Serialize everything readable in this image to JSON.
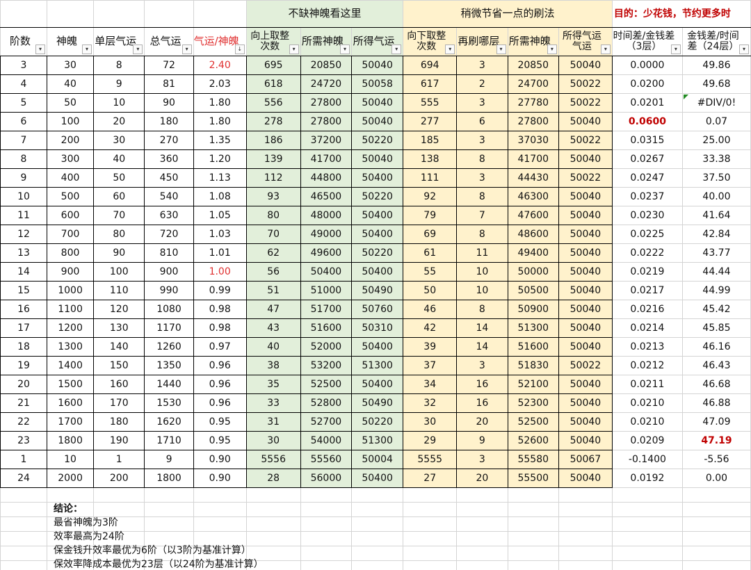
{
  "title_row": {
    "green_title": "不缺神魄看这里",
    "yellow_title": "稍微节省一点的刷法",
    "goal_text": "目的：少花钱，节约更多时"
  },
  "headers": [
    {
      "label": "阶数",
      "style": "normal"
    },
    {
      "label": "神魄",
      "style": "normal"
    },
    {
      "label": "单层气运",
      "style": "normal"
    },
    {
      "label": "总气运",
      "style": "normal"
    },
    {
      "label": "气运/神魄",
      "style": "red",
      "sort_icon": "sort-desc-icon"
    },
    {
      "label": "向上取整次数",
      "style": "green",
      "two_line": true
    },
    {
      "label": "所需神魄",
      "style": "green"
    },
    {
      "label": "所得气运",
      "style": "green"
    },
    {
      "label": "向下取整次数",
      "style": "yellow",
      "two_line": true
    },
    {
      "label": "再刷哪层",
      "style": "yellow"
    },
    {
      "label": "所需神魄",
      "style": "yellow"
    },
    {
      "label": "所得气运气运",
      "style": "yellow",
      "two_line": true
    },
    {
      "label": "时间差/金钱差（3层）",
      "style": "normal",
      "two_line": true
    },
    {
      "label": "金钱差/时间差（24层）",
      "style": "normal",
      "two_line": true
    }
  ],
  "rows": [
    {
      "cells": [
        "3",
        "30",
        "8",
        "72",
        "2.40",
        "695",
        "20850",
        "50040",
        "694",
        "3",
        "20850",
        "50040",
        "0.0000",
        "49.86"
      ],
      "flags": {
        "4": "red"
      }
    },
    {
      "cells": [
        "4",
        "40",
        "9",
        "81",
        "2.03",
        "618",
        "24720",
        "50058",
        "617",
        "2",
        "24700",
        "50022",
        "0.0200",
        "49.68"
      ]
    },
    {
      "cells": [
        "5",
        "50",
        "10",
        "90",
        "1.80",
        "556",
        "27800",
        "50040",
        "555",
        "3",
        "27780",
        "50022",
        "0.0201",
        "#DIV/0!"
      ],
      "flags": {
        "13": "tri"
      }
    },
    {
      "cells": [
        "6",
        "100",
        "20",
        "180",
        "1.80",
        "278",
        "27800",
        "50040",
        "277",
        "6",
        "27800",
        "50040",
        "0.0600",
        "0.07"
      ],
      "flags": {
        "12": "bold-red"
      }
    },
    {
      "cells": [
        "7",
        "200",
        "30",
        "270",
        "1.35",
        "186",
        "37200",
        "50220",
        "185",
        "3",
        "37030",
        "50022",
        "0.0315",
        "25.00"
      ]
    },
    {
      "cells": [
        "8",
        "300",
        "40",
        "360",
        "1.20",
        "139",
        "41700",
        "50040",
        "138",
        "8",
        "41700",
        "50040",
        "0.0267",
        "33.38"
      ]
    },
    {
      "cells": [
        "9",
        "400",
        "50",
        "450",
        "1.13",
        "112",
        "44800",
        "50400",
        "111",
        "3",
        "44430",
        "50022",
        "0.0247",
        "37.50"
      ]
    },
    {
      "cells": [
        "10",
        "500",
        "60",
        "540",
        "1.08",
        "93",
        "46500",
        "50220",
        "92",
        "8",
        "46300",
        "50040",
        "0.0237",
        "40.00"
      ]
    },
    {
      "cells": [
        "11",
        "600",
        "70",
        "630",
        "1.05",
        "80",
        "48000",
        "50400",
        "79",
        "7",
        "47600",
        "50040",
        "0.0230",
        "41.64"
      ]
    },
    {
      "cells": [
        "12",
        "700",
        "80",
        "720",
        "1.03",
        "70",
        "49000",
        "50400",
        "69",
        "8",
        "48600",
        "50040",
        "0.0225",
        "42.84"
      ]
    },
    {
      "cells": [
        "13",
        "800",
        "90",
        "810",
        "1.01",
        "62",
        "49600",
        "50220",
        "61",
        "11",
        "49400",
        "50040",
        "0.0222",
        "43.77"
      ]
    },
    {
      "cells": [
        "14",
        "900",
        "100",
        "900",
        "1.00",
        "56",
        "50400",
        "50400",
        "55",
        "10",
        "50000",
        "50040",
        "0.0219",
        "44.44"
      ],
      "flags": {
        "4": "red"
      }
    },
    {
      "cells": [
        "15",
        "1000",
        "110",
        "990",
        "0.99",
        "51",
        "51000",
        "50490",
        "50",
        "10",
        "50500",
        "50040",
        "0.0217",
        "44.99"
      ]
    },
    {
      "cells": [
        "16",
        "1100",
        "120",
        "1080",
        "0.98",
        "47",
        "51700",
        "50760",
        "46",
        "8",
        "50900",
        "50040",
        "0.0216",
        "45.42"
      ]
    },
    {
      "cells": [
        "17",
        "1200",
        "130",
        "1170",
        "0.98",
        "43",
        "51600",
        "50310",
        "42",
        "14",
        "51300",
        "50040",
        "0.0214",
        "45.85"
      ]
    },
    {
      "cells": [
        "18",
        "1300",
        "140",
        "1260",
        "0.97",
        "40",
        "52000",
        "50400",
        "39",
        "14",
        "51600",
        "50040",
        "0.0213",
        "46.16"
      ]
    },
    {
      "cells": [
        "19",
        "1400",
        "150",
        "1350",
        "0.96",
        "38",
        "53200",
        "51300",
        "37",
        "3",
        "51830",
        "50022",
        "0.0212",
        "46.43"
      ]
    },
    {
      "cells": [
        "20",
        "1500",
        "160",
        "1440",
        "0.96",
        "35",
        "52500",
        "50400",
        "34",
        "16",
        "52100",
        "50040",
        "0.0211",
        "46.68"
      ]
    },
    {
      "cells": [
        "21",
        "1600",
        "170",
        "1530",
        "0.96",
        "33",
        "52800",
        "50490",
        "32",
        "16",
        "52300",
        "50040",
        "0.0210",
        "46.88"
      ]
    },
    {
      "cells": [
        "22",
        "1700",
        "180",
        "1620",
        "0.95",
        "31",
        "52700",
        "50220",
        "30",
        "20",
        "52500",
        "50040",
        "0.0210",
        "47.09"
      ]
    },
    {
      "cells": [
        "23",
        "1800",
        "190",
        "1710",
        "0.95",
        "30",
        "54000",
        "51300",
        "29",
        "9",
        "52600",
        "50040",
        "0.0209",
        "47.19"
      ],
      "flags": {
        "13": "bold-red"
      }
    },
    {
      "cells": [
        "1",
        "10",
        "1",
        "9",
        "0.90",
        "5556",
        "55560",
        "50004",
        "5555",
        "3",
        "55580",
        "50067",
        "-0.1400",
        "-5.56"
      ]
    },
    {
      "cells": [
        "24",
        "2000",
        "200",
        "1800",
        "0.90",
        "28",
        "56000",
        "50400",
        "27",
        "20",
        "55500",
        "50040",
        "0.0192",
        "0.00"
      ]
    }
  ],
  "notes": {
    "title": "结论：",
    "lines": [
      "最省神魄为3阶",
      "效率最高为24阶",
      "保金钱升效率最优为6阶（以3阶为基准计算）",
      "保效率降成本最优为23层（以24阶为基准计算）"
    ]
  }
}
